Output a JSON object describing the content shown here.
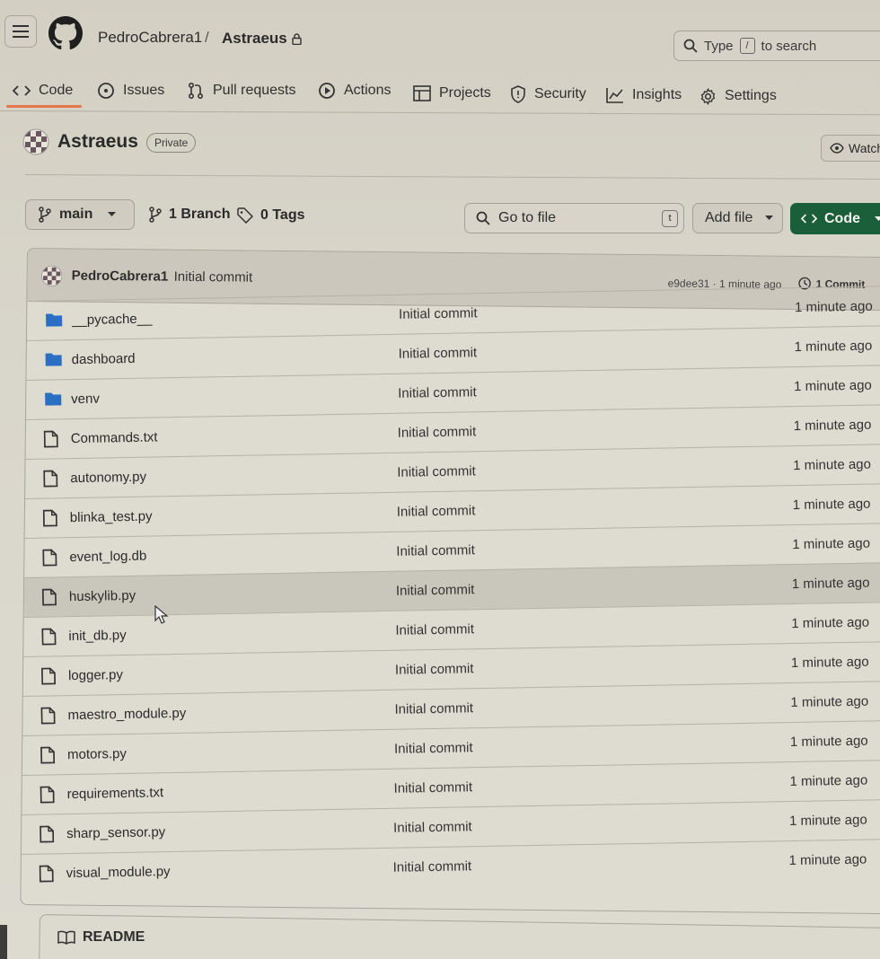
{
  "header": {
    "owner": "PedroCabrera1",
    "separator": "/",
    "repo": "Astraeus",
    "search_prefix": "Type",
    "search_key": "/",
    "search_suffix": "to search"
  },
  "nav": {
    "tabs": [
      {
        "label": "Code",
        "icon": "code-icon"
      },
      {
        "label": "Issues",
        "icon": "issue-icon"
      },
      {
        "label": "Pull requests",
        "icon": "pull-request-icon"
      },
      {
        "label": "Actions",
        "icon": "play-icon"
      },
      {
        "label": "Projects",
        "icon": "table-icon"
      },
      {
        "label": "Security",
        "icon": "shield-icon"
      },
      {
        "label": "Insights",
        "icon": "graph-icon"
      },
      {
        "label": "Settings",
        "icon": "gear-icon"
      }
    ]
  },
  "repo": {
    "title": "Astraeus",
    "visibility": "Private",
    "watch_label": "Watch"
  },
  "toolbar": {
    "branch": "main",
    "branch_count": "1 Branch",
    "tag_count": "0 Tags",
    "goto_placeholder": "Go to file",
    "goto_key": "t",
    "add_file": "Add file",
    "code_button": "Code"
  },
  "commit": {
    "author": "PedroCabrera1",
    "message": "Initial commit",
    "meta": "e9dee31 · 1 minute ago",
    "count": "1 Commit"
  },
  "files": [
    {
      "name": "__pycache__",
      "type": "folder",
      "message": "Initial commit",
      "time": "1 minute ago"
    },
    {
      "name": "dashboard",
      "type": "folder",
      "message": "Initial commit",
      "time": "1 minute ago"
    },
    {
      "name": "venv",
      "type": "folder",
      "message": "Initial commit",
      "time": "1 minute ago"
    },
    {
      "name": "Commands.txt",
      "type": "file",
      "message": "Initial commit",
      "time": "1 minute ago"
    },
    {
      "name": "autonomy.py",
      "type": "file",
      "message": "Initial commit",
      "time": "1 minute ago"
    },
    {
      "name": "blinka_test.py",
      "type": "file",
      "message": "Initial commit",
      "time": "1 minute ago"
    },
    {
      "name": "event_log.db",
      "type": "file",
      "message": "Initial commit",
      "time": "1 minute ago"
    },
    {
      "name": "huskylib.py",
      "type": "file",
      "message": "Initial commit",
      "time": "1 minute ago"
    },
    {
      "name": "init_db.py",
      "type": "file",
      "message": "Initial commit",
      "time": "1 minute ago"
    },
    {
      "name": "logger.py",
      "type": "file",
      "message": "Initial commit",
      "time": "1 minute ago"
    },
    {
      "name": "maestro_module.py",
      "type": "file",
      "message": "Initial commit",
      "time": "1 minute ago"
    },
    {
      "name": "motors.py",
      "type": "file",
      "message": "Initial commit",
      "time": "1 minute ago"
    },
    {
      "name": "requirements.txt",
      "type": "file",
      "message": "Initial commit",
      "time": "1 minute ago"
    },
    {
      "name": "sharp_sensor.py",
      "type": "file",
      "message": "Initial commit",
      "time": "1 minute ago"
    },
    {
      "name": "visual_module.py",
      "type": "file",
      "message": "Initial commit",
      "time": "1 minute ago"
    }
  ],
  "readme": {
    "label": "README"
  },
  "colors": {
    "accent_underline": "#e5774b",
    "code_button_bg": "#1a5e3a",
    "folder_icon": "#2a6fc4"
  }
}
